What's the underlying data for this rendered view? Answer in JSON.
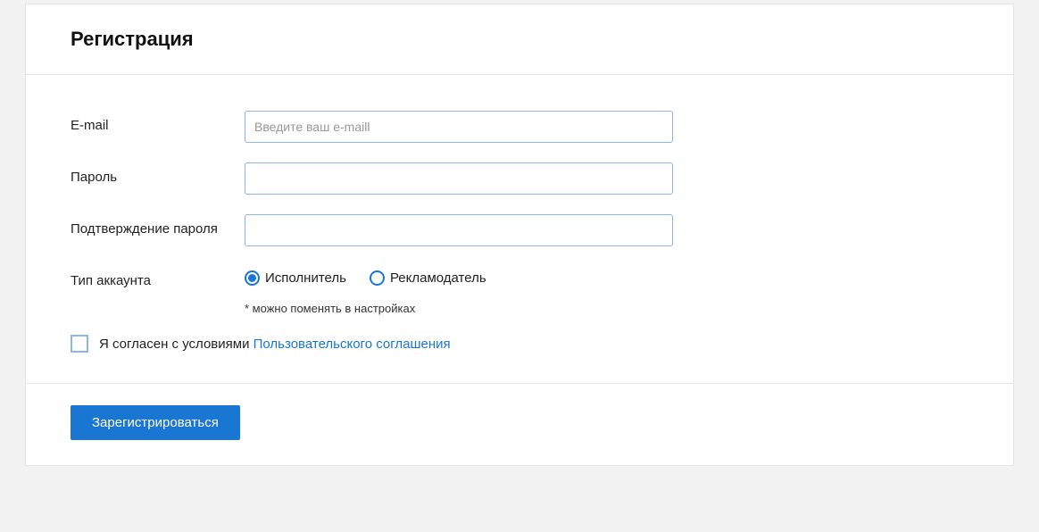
{
  "header": {
    "title": "Регистрация"
  },
  "form": {
    "email": {
      "label": "E-mail",
      "placeholder": "Введите ваш e-maill",
      "value": ""
    },
    "password": {
      "label": "Пароль",
      "value": ""
    },
    "password_confirm": {
      "label": "Подтверждение пароля",
      "value": ""
    },
    "account_type": {
      "label": "Тип аккаунта",
      "options": [
        {
          "label": "Исполнитель",
          "checked": true
        },
        {
          "label": "Рекламодатель",
          "checked": false
        }
      ],
      "hint": "* можно поменять в настройках"
    },
    "agreement": {
      "checked": false,
      "text_prefix": "Я согласен с условиями ",
      "link_text": "Пользовательского соглашения"
    }
  },
  "footer": {
    "submit_label": "Зарегистрироваться"
  }
}
